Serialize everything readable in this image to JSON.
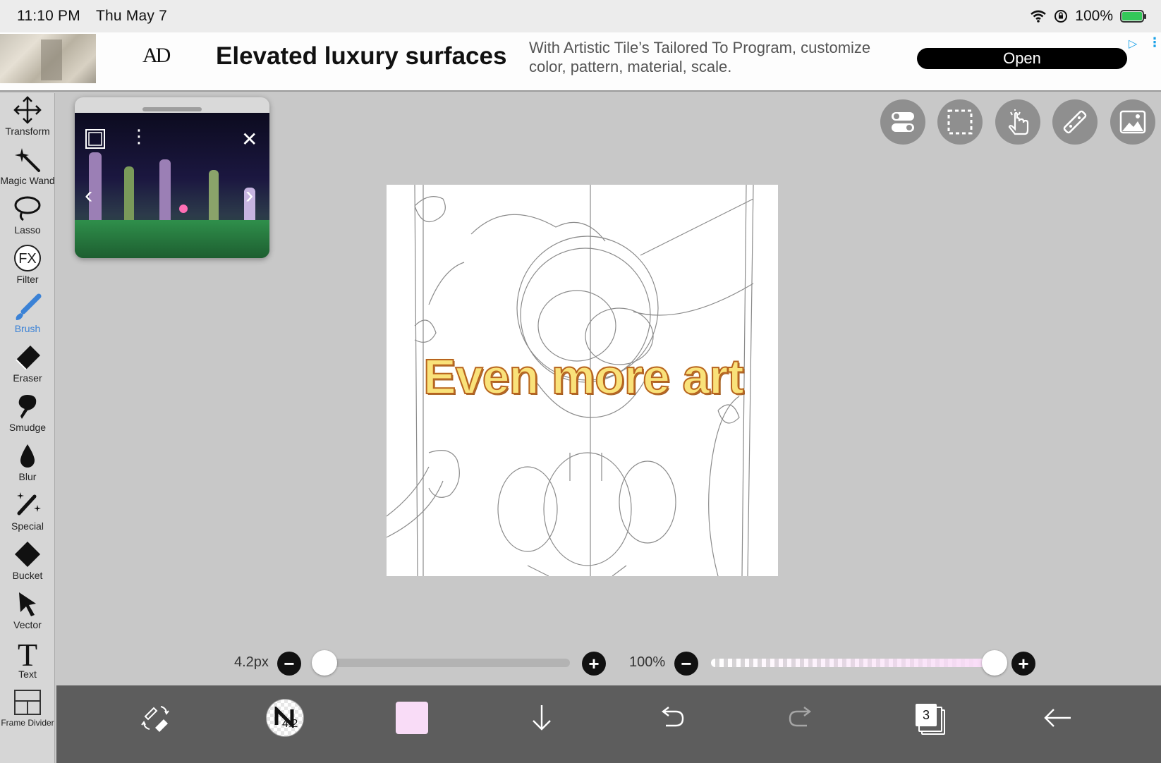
{
  "status": {
    "time": "11:10 PM",
    "date": "Thu May 7",
    "battery": "100%"
  },
  "ad": {
    "logo": "AD",
    "headline": "Elevated luxury surfaces",
    "description": "With Artistic Tile’s Tailored To Program, customize color, pattern, material, scale.",
    "cta": "Open"
  },
  "tools": [
    {
      "label": "Transform",
      "icon": "move-arrows-icon"
    },
    {
      "label": "Magic Wand",
      "icon": "magic-wand-icon"
    },
    {
      "label": "Lasso",
      "icon": "lasso-icon"
    },
    {
      "label": "Filter",
      "icon": "fx-filter-icon"
    },
    {
      "label": "Brush",
      "icon": "brush-icon",
      "active": true
    },
    {
      "label": "Eraser",
      "icon": "eraser-icon"
    },
    {
      "label": "Smudge",
      "icon": "smudge-icon"
    },
    {
      "label": "Blur",
      "icon": "blur-drop-icon"
    },
    {
      "label": "Special",
      "icon": "special-sparkle-icon"
    },
    {
      "label": "Bucket",
      "icon": "bucket-icon"
    },
    {
      "label": "Vector",
      "icon": "vector-cursor-icon"
    },
    {
      "label": "Text",
      "icon": "text-t-icon"
    },
    {
      "label": "Frame Divider",
      "icon": "frame-divider-icon"
    }
  ],
  "canvas": {
    "overlay_text": "Even more art"
  },
  "brush": {
    "size_label": "4.2px",
    "size_fraction": 0.0,
    "opacity_label": "100%",
    "opacity_fraction": 1.0
  },
  "bottom": {
    "brush_size_badge": "4.2",
    "color": "#f9dcf7",
    "layer_count": "3"
  },
  "colors": {
    "active_tool": "#3b82d6",
    "toolbar_bg": "#d6d6d6",
    "bottom_bar": "#5d5d5d",
    "ad_cta": "#000000"
  }
}
